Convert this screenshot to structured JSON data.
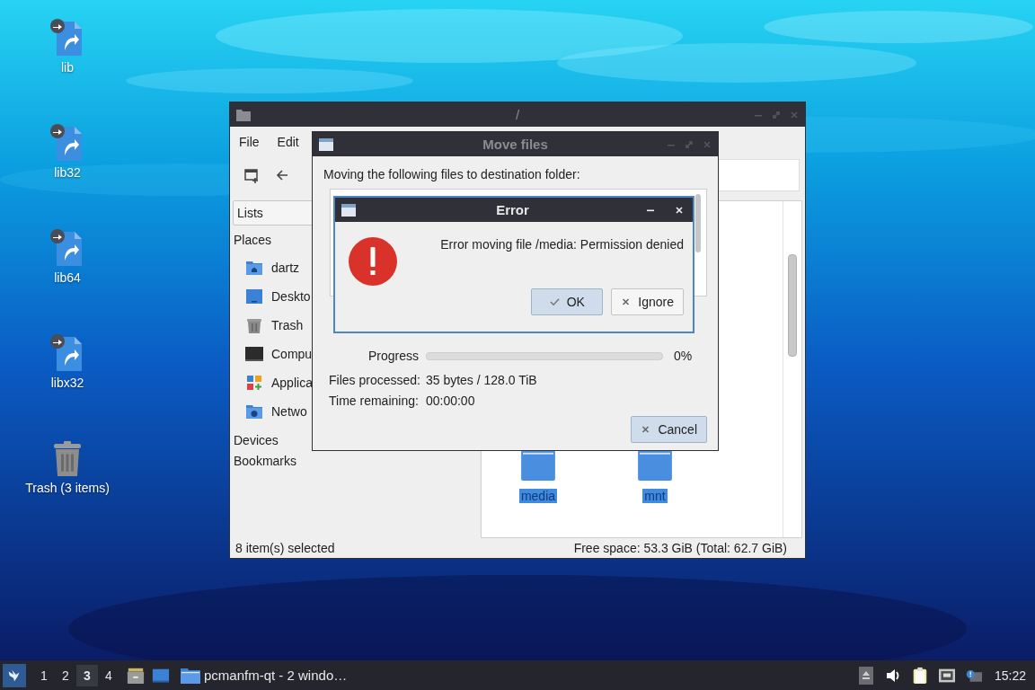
{
  "desktop_icons": [
    {
      "label": "lib",
      "kind": "link"
    },
    {
      "label": "lib32",
      "kind": "link"
    },
    {
      "label": "lib64",
      "kind": "link"
    },
    {
      "label": "libx32",
      "kind": "link"
    },
    {
      "label": "Trash (3 items)",
      "kind": "trash"
    }
  ],
  "file_manager": {
    "title": "/",
    "menu": [
      "File",
      "Edit"
    ],
    "sidebar": {
      "dropdown": "Lists",
      "sections": [
        {
          "title": "Places",
          "items": [
            {
              "label": "dartz",
              "kind": "home"
            },
            {
              "label": "Deskto",
              "kind": "desktop"
            },
            {
              "label": "Trash",
              "kind": "trash"
            },
            {
              "label": "Compu",
              "kind": "computer"
            },
            {
              "label": "Applica",
              "kind": "applications"
            },
            {
              "label": "Netwo",
              "kind": "network"
            }
          ]
        },
        {
          "title": "Devices"
        },
        {
          "title": "Bookmarks"
        }
      ]
    },
    "files": [
      {
        "name": "media",
        "selected": true
      },
      {
        "name": "mnt",
        "selected": true
      }
    ],
    "status_left": "8 item(s) selected",
    "status_right": "Free space: 53.3 GiB (Total: 62.7 GiB)"
  },
  "move_dialog": {
    "title": "Move files",
    "active": false,
    "heading": "Moving the following files to destination folder:",
    "progress": {
      "label": "Progress",
      "level": 0,
      "reading": "0%"
    },
    "details": [
      {
        "label": "Files processed:",
        "value": "35 bytes / 128.0 TiB"
      },
      {
        "label": "Time remaining:",
        "value": "00:00:00"
      }
    ],
    "cancel": "Cancel"
  },
  "error_dialog": {
    "title": "Error",
    "active": true,
    "message": "Error moving file /media: Permission denied",
    "buttons": [
      {
        "label": "OK",
        "kind": "ok",
        "default": true
      },
      {
        "label": "Ignore",
        "kind": "ignore",
        "default": false
      }
    ]
  },
  "taskbar": {
    "workspaces": [
      {
        "label": "1",
        "selected": false
      },
      {
        "label": "2",
        "selected": false
      },
      {
        "label": "3",
        "selected": true
      },
      {
        "label": "4",
        "selected": false
      }
    ],
    "task": "pcmanfm-qt - 2 windo…",
    "clock": "15:22"
  }
}
